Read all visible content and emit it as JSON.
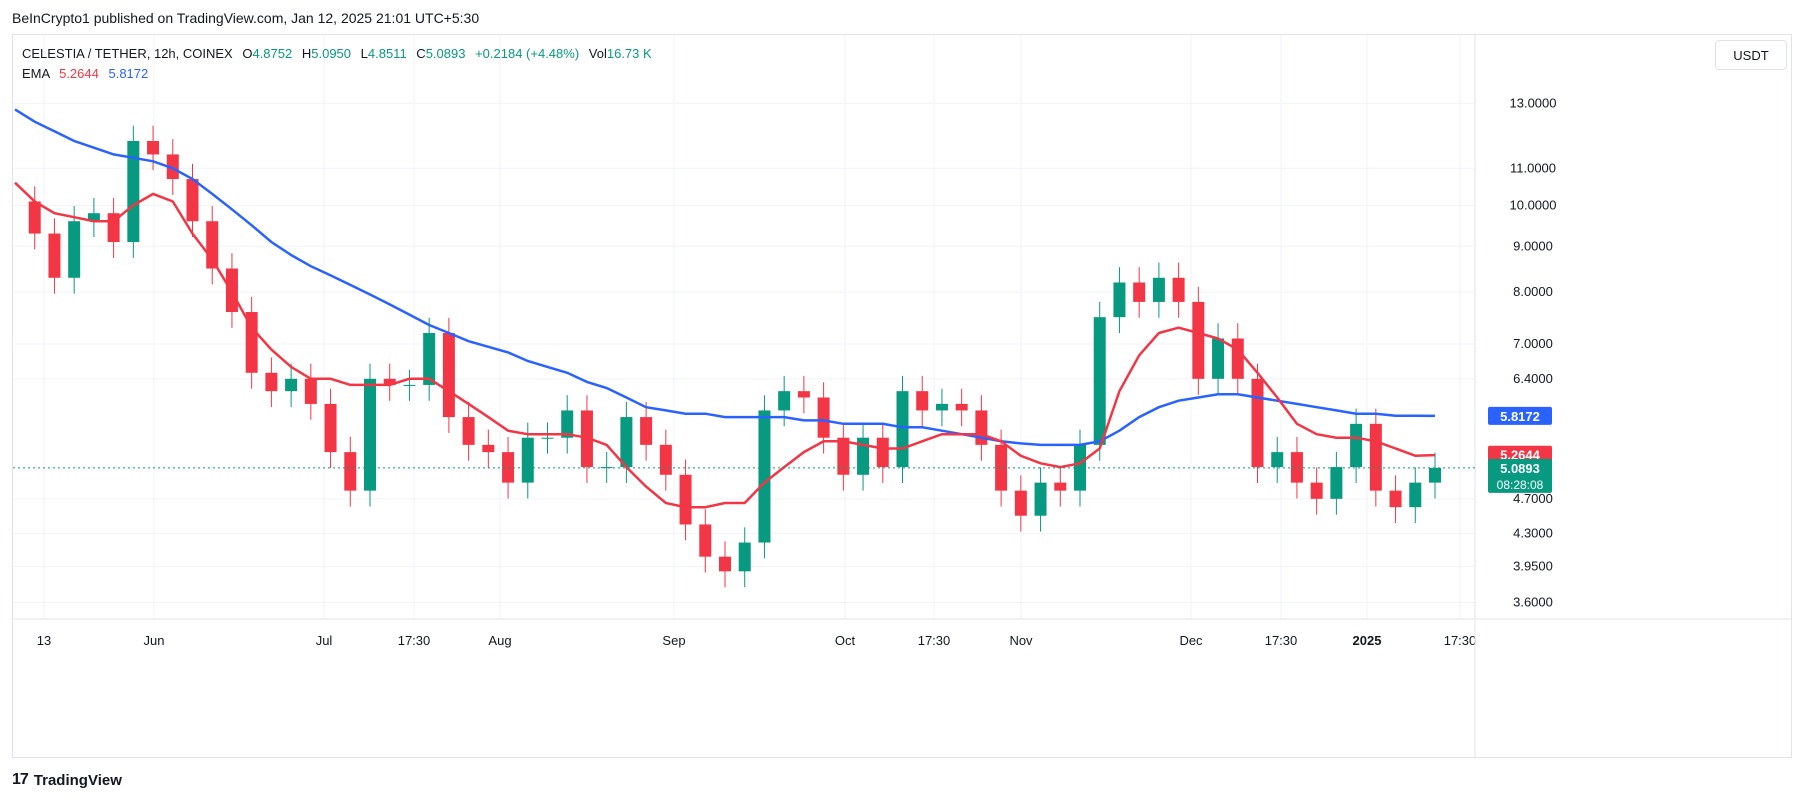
{
  "header": {
    "attribution": "BeInCrypto1 published on TradingView.com, Jan 12, 2025 21:01 UTC+5:30"
  },
  "legend": {
    "symbol": "CELESTIA / TETHER, 12h, COINEX",
    "o_label": "O",
    "o_value": "4.8752",
    "h_label": "H",
    "h_value": "5.0950",
    "l_label": "L",
    "l_value": "4.8511",
    "c_label": "C",
    "c_value": "5.0893",
    "change": "+0.2184 (+4.48%)",
    "vol_label": "Vol",
    "vol_value": "16.73 K",
    "ema_label": "EMA",
    "ema_short": "5.2644",
    "ema_long": "5.8172"
  },
  "currency_button": "USDT",
  "footer": {
    "brand_logo": "tv-logo-icon",
    "brand": "TradingView"
  },
  "colors": {
    "up": "#089981",
    "down": "#f23645",
    "ema_short": "#f23645",
    "ema_long": "#2962ff",
    "last_price": "#089981",
    "grid": "#f0f3fa"
  },
  "chart_data": {
    "type": "candlestick",
    "title": "CELESTIA / TETHER, 12h, COINEX",
    "x_tick_labels": [
      "13",
      "Jun",
      "Jul",
      "17:30",
      "Aug",
      "Sep",
      "Oct",
      "17:30",
      "Nov",
      "Dec",
      "17:30",
      "2025",
      "17:30"
    ],
    "y_tick_labels": [
      "13.0000",
      "11.0000",
      "10.0000",
      "9.0000",
      "8.0000",
      "7.0000",
      "6.4000",
      "5.8172",
      "5.2644",
      "5.0893",
      "4.7000",
      "4.3000",
      "3.9500",
      "3.6000"
    ],
    "y_scale": "log",
    "ylim": [
      3.45,
      15.5
    ],
    "grid": true,
    "last_price": "5.0893",
    "countdown": "08:28:08",
    "price_markers": [
      {
        "series": "EMA long",
        "value": "5.8172"
      },
      {
        "series": "EMA short",
        "value": "5.2644"
      }
    ],
    "series": [
      {
        "name": "close (approx.)",
        "values": [
          10.1,
          9.3,
          8.3,
          9.6,
          9.8,
          9.1,
          11.8,
          11.4,
          10.7,
          9.6,
          8.5,
          7.6,
          6.5,
          6.2,
          6.4,
          6.0,
          5.3,
          4.8,
          6.4,
          6.3,
          6.3,
          7.2,
          5.8,
          5.4,
          5.3,
          4.9,
          5.5,
          5.5,
          5.9,
          5.1,
          5.1,
          5.8,
          5.4,
          5.0,
          4.4,
          4.05,
          3.9,
          4.2,
          5.9,
          6.2,
          6.1,
          5.5,
          5.0,
          5.5,
          5.1,
          6.2,
          5.9,
          6.0,
          5.9,
          5.4,
          4.8,
          4.5,
          4.9,
          4.8,
          5.4,
          7.5,
          8.2,
          7.8,
          8.3,
          7.8,
          6.4,
          7.1,
          6.4,
          5.1,
          5.3,
          4.9,
          4.7,
          5.1,
          5.7,
          4.8,
          4.6,
          4.9,
          5.09
        ]
      },
      {
        "name": "EMA short",
        "values": [
          10.6,
          10.1,
          9.8,
          9.7,
          9.6,
          9.6,
          10.0,
          10.3,
          10.1,
          9.3,
          8.7,
          8.0,
          7.3,
          6.9,
          6.6,
          6.4,
          6.4,
          6.3,
          6.3,
          6.3,
          6.4,
          6.4,
          6.2,
          6.0,
          5.8,
          5.6,
          5.55,
          5.55,
          5.55,
          5.5,
          5.4,
          5.1,
          4.85,
          4.65,
          4.6,
          4.6,
          4.65,
          4.65,
          4.9,
          5.1,
          5.3,
          5.45,
          5.45,
          5.4,
          5.35,
          5.35,
          5.45,
          5.55,
          5.55,
          5.55,
          5.45,
          5.25,
          5.15,
          5.1,
          5.15,
          5.35,
          6.2,
          6.8,
          7.2,
          7.3,
          7.2,
          7.1,
          6.9,
          6.5,
          6.1,
          5.7,
          5.55,
          5.5,
          5.5,
          5.45,
          5.35,
          5.25,
          5.26
        ]
      },
      {
        "name": "EMA long",
        "values": [
          12.8,
          12.4,
          12.1,
          11.8,
          11.6,
          11.4,
          11.3,
          11.2,
          11.0,
          10.7,
          10.3,
          9.9,
          9.5,
          9.1,
          8.8,
          8.55,
          8.35,
          8.15,
          7.95,
          7.75,
          7.55,
          7.35,
          7.2,
          7.05,
          6.95,
          6.85,
          6.7,
          6.6,
          6.5,
          6.35,
          6.25,
          6.1,
          5.95,
          5.9,
          5.85,
          5.85,
          5.8,
          5.8,
          5.8,
          5.8,
          5.75,
          5.75,
          5.7,
          5.7,
          5.7,
          5.65,
          5.65,
          5.6,
          5.55,
          5.5,
          5.45,
          5.42,
          5.4,
          5.4,
          5.4,
          5.45,
          5.6,
          5.8,
          5.95,
          6.05,
          6.1,
          6.15,
          6.15,
          6.1,
          6.05,
          6.0,
          5.95,
          5.9,
          5.85,
          5.85,
          5.82,
          5.82,
          5.8172
        ]
      }
    ]
  }
}
